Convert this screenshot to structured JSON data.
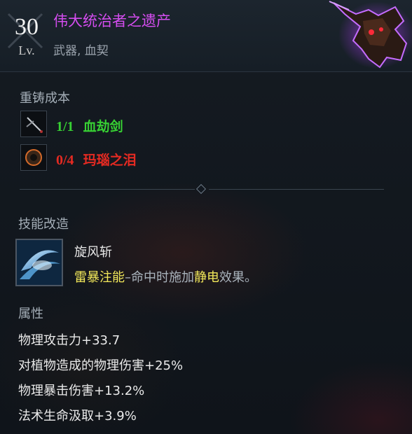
{
  "item": {
    "level": "30",
    "level_label": "Lv.",
    "name": "伟大统治者之遗产",
    "type": "武器, 血契"
  },
  "reforge": {
    "title": "重铸成本",
    "materials": [
      {
        "count": "1/1",
        "name": "血劫剑",
        "status_color": "#37d033"
      },
      {
        "count": "0/4",
        "name": "玛瑙之泪",
        "status_color": "#e52a22"
      }
    ]
  },
  "skill_mod": {
    "title": "技能改造",
    "skill_name": "旋风斩",
    "desc_highlight_1": "雷暴注能",
    "desc_dash": "–命中时施加",
    "desc_highlight_2": "静电",
    "desc_tail": "效果。"
  },
  "attributes": {
    "title": "属性",
    "items": [
      "物理攻击力+33.7",
      "对植物造成的物理伤害+25%",
      "物理暴击伤害+13.2%",
      "法术生命汲取+3.9%"
    ]
  },
  "colors": {
    "name_purple": "#d54df0",
    "highlight_yellow": "#f2e85a",
    "ok_green": "#37d033",
    "missing_red": "#e52a22"
  },
  "icons": [
    "sword-icon",
    "agate-tear-icon",
    "whirlwind-skill-icon",
    "weapon-artwork-icon",
    "crossed-swords-icon"
  ]
}
